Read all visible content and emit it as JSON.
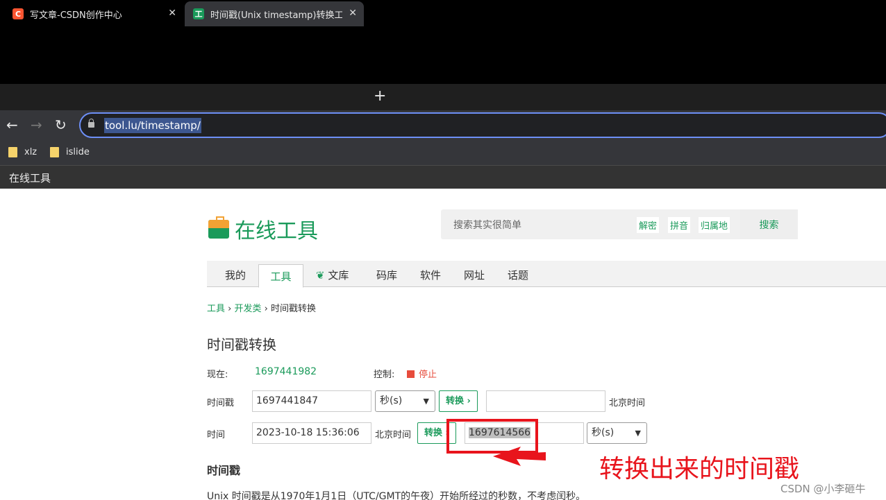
{
  "browser": {
    "tabs": [
      {
        "favicon_letter": "C",
        "favicon_color": "#fc5531",
        "title": "写文章-CSDN创作中心",
        "close": "✕"
      },
      {
        "favicon_letter": "工",
        "favicon_color": "#1a9a5a",
        "title": "时间戳(Unix timestamp)转换工具",
        "close": "✕"
      }
    ],
    "new_tab": "+",
    "nav": {
      "back": "←",
      "forward": "→",
      "reload": "↻"
    },
    "url": "tool.lu/timestamp/",
    "bookmarks": [
      "xlz",
      "islide"
    ],
    "site_strip": "在线工具"
  },
  "site": {
    "logo_text": "在线工具",
    "search_placeholder": "搜索其实很简单",
    "search_chips": [
      "解密",
      "拼音",
      "归属地"
    ],
    "search_button": "搜索",
    "nav": [
      "我的",
      "工具",
      "文库",
      "码库",
      "软件",
      "网址",
      "话题"
    ],
    "active_nav": "工具"
  },
  "breadcrumb": [
    "工具",
    "开发类",
    "时间戳转换"
  ],
  "breadcrumb_sep": "›",
  "page_title": "时间戳转换",
  "now": {
    "label": "现在:",
    "value": "1697441982",
    "control_label": "控制:",
    "stop_label": "停止"
  },
  "row1": {
    "label": "时间戳",
    "input_value": "1697441847",
    "unit": "秒(s)",
    "button": "转换 ›",
    "result": "",
    "tz": "北京时间"
  },
  "row2": {
    "label": "时间",
    "input_value": "2023-10-18 15:36:06",
    "tz": "北京时间",
    "button": "转换 ›",
    "result": "1697614566",
    "unit": "秒(s)"
  },
  "annotation": "转换出来的时间戳",
  "section_title": "时间戳",
  "description": "Unix 时间戳是从1970年1月1日（UTC/GMT的午夜）开始所经过的秒数，不考虑闰秒。",
  "watermark": "CSDN @小李砸牛",
  "colors": {
    "brand_green": "#1a9a5a",
    "annotation_red": "#e8141c",
    "stop_red": "#e74c3c"
  }
}
